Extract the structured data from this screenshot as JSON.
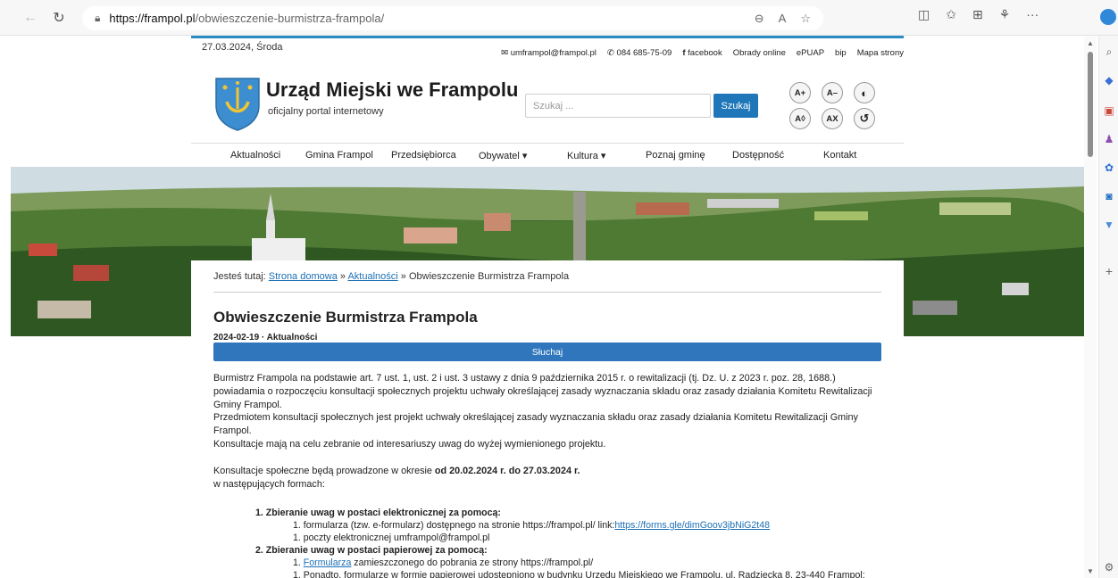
{
  "browser": {
    "url_domain": "https://frampol.pl",
    "url_path": "/obwieszczenie-burmistrza-frampola/"
  },
  "site": {
    "date": "27.03.2024, Środa",
    "top_links": [
      "umframpol@frampol.pl",
      "084 685-75-09",
      "facebook",
      "Obrady online",
      "ePUAP",
      "bip",
      "Mapa strony"
    ],
    "title": "Urząd Miejski we Frampolu",
    "subtitle": "oficjalny portal internetowy",
    "search_placeholder": "Szukaj ...",
    "search_button": "Szukaj",
    "accessibility": [
      "A+",
      "A–",
      "A◊",
      "AX"
    ],
    "menu": [
      "Aktualności",
      "Gmina Frampol",
      "Przedsiębiorca",
      "Obywatel ▾",
      "Kultura ▾",
      "Poznaj gminę",
      "Dostępność",
      "Kontakt"
    ]
  },
  "breadcrumb": {
    "prefix": "Jesteś tutaj:",
    "home": "Strona domowa",
    "sep": "»",
    "news": "Aktualności",
    "current": "Obwieszczenie Burmistrza Frampola"
  },
  "post": {
    "title": "Obwieszczenie Burmistrza Frampola",
    "meta": "2024-02-19 · Aktualności",
    "listen": "Słuchaj",
    "p1": "Burmistrz Frampola na podstawie art. 7 ust. 1, ust. 2 i ust. 3 ustawy z dnia 9 października 2015 r. o rewitalizacji (tj. Dz. U. z 2023 r. poz. 28, 1688.) powiadamia o rozpoczęciu konsultacji społecznych projektu uchwały określającej zasady wyznaczania składu oraz zasady działania Komitetu Rewitalizacji Gminy Frampol.",
    "p2": "Przedmiotem konsultacji społecznych jest projekt uchwały określającej zasady wyznaczania składu oraz zasady działania Komitetu Rewitalizacji Gminy Frampol.",
    "p3": "Konsultacje mają na celu zebranie od interesariuszy uwag do wyżej wymienionego projektu.",
    "p4_pre": "Konsultacje społeczne będą prowadzone w okresie ",
    "p4_bold": "od 20.02.2024 r. do 27.03.2024 r.",
    "p4_post": "w następujących formach:",
    "l1": "1. Zbieranie uwag w postaci elektronicznej za pomocą:",
    "l1a_pre": "1. formularza (tzw. e-formularz) dostępnego na stronie https://frampol.pl/ link:",
    "l1a_link": "https://forms.gle/dimGoov3jbNiG2t48",
    "l1b": "1. poczty elektronicznej umframpol@frampol.pl",
    "l2": "2. Zbieranie uwag w postaci papierowej za pomocą:",
    "l2a_link": "Formularza",
    "l2a_post": " zamieszczonego do pobrania ze strony  https://frampol.pl/",
    "l2b": "1. Ponadto, formularze w formie papierowej udostępniono w budynku Urzędu Miejskiego we Frampolu, ul. Radziecka 8, 23-440 Frampol;"
  }
}
